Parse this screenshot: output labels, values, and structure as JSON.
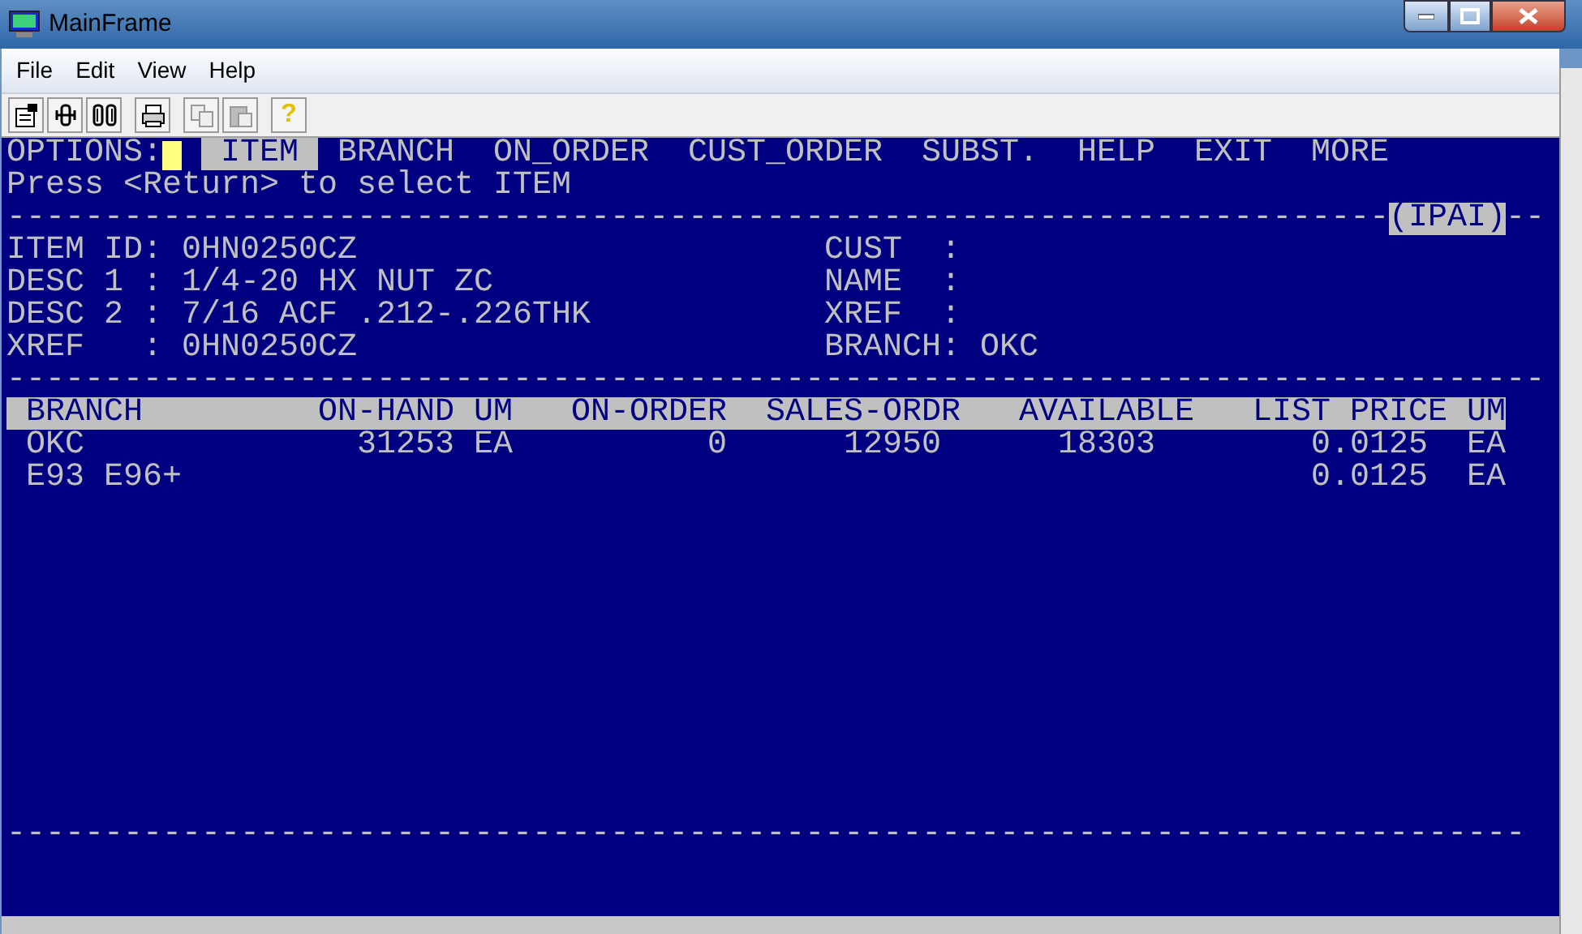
{
  "window": {
    "title": "MainFrame"
  },
  "menu": [
    "File",
    "Edit",
    "View",
    "Help"
  ],
  "toolbar": [
    {
      "kind": "properties",
      "disabled": false
    },
    {
      "kind": "connect",
      "disabled": false
    },
    {
      "kind": "disconnect",
      "disabled": false
    },
    {
      "kind": "print",
      "disabled": false
    },
    {
      "kind": "copy",
      "disabled": true
    },
    {
      "kind": "paste",
      "disabled": true
    },
    {
      "kind": "help",
      "disabled": false,
      "glyph": "?"
    }
  ],
  "terminal": {
    "options_label": "OPTIONS:",
    "options": [
      {
        "label": "ITEM",
        "selected": true
      },
      {
        "label": "BRANCH",
        "selected": false
      },
      {
        "label": "ON_ORDER",
        "selected": false
      },
      {
        "label": "CUST_ORDER",
        "selected": false
      },
      {
        "label": "SUBST.",
        "selected": false
      },
      {
        "label": "HELP",
        "selected": false
      },
      {
        "label": "EXIT",
        "selected": false
      },
      {
        "label": "MORE",
        "selected": false
      }
    ],
    "prompt": "Press <Return> to select ITEM",
    "rule": "-----------------------------------------------------------------------",
    "screen_id": "(IPAI)",
    "rule_tail": "--",
    "fields_left": [
      {
        "label": "ITEM ID:",
        "value": "0HN0250CZ"
      },
      {
        "label": "DESC 1 :",
        "value": "1/4-20 HX NUT ZC"
      },
      {
        "label": "DESC 2 :",
        "value": "7/16 ACF .212-.226THK"
      },
      {
        "label": "XREF   :",
        "value": "0HN0250CZ"
      }
    ],
    "fields_right": [
      {
        "label": "CUST  :"
      },
      {
        "label": "NAME  :"
      },
      {
        "label": "XREF  :"
      },
      {
        "label": "BRANCH:",
        "value": "OKC"
      }
    ],
    "rule_2": "-------------------------------------------------------------------------------",
    "table": {
      "columns": [
        "BRANCH",
        "ON-HAND",
        "UM",
        "ON-ORDER",
        "SALES-ORDR",
        "AVAILABLE",
        "LIST PRICE",
        "UM"
      ],
      "rows": [
        {
          "branch": "OKC",
          "on_hand": "31253",
          "um": "EA",
          "on_order": "0",
          "sales_ordr": "12950",
          "available": "18303",
          "list_price": "0.0125",
          "um_2": "EA"
        },
        {
          "branch": "E93 E96+",
          "list_price": "0.0125",
          "um_2": "EA"
        }
      ]
    },
    "rule_3": "------------------------------------------------------------------------------"
  }
}
